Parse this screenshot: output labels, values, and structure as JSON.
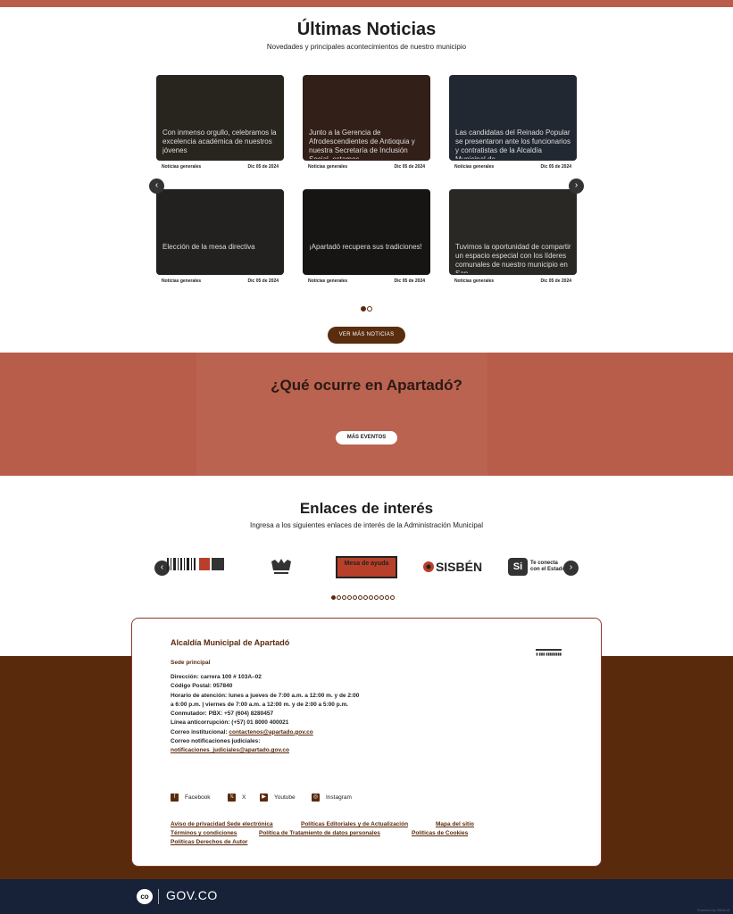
{
  "news": {
    "title": "Últimas Noticias",
    "subtitle": "Novedades y principales acontecimientos de nuestro municipio",
    "prev_arrow": "‹",
    "next_arrow": "›",
    "cards": [
      {
        "title": "Con inmenso orgullo, celebramos la excelencia académica de nuestros jóvenes",
        "category": "Noticias generales",
        "date": "Dic 05 de 2024",
        "color": "#4a4238"
      },
      {
        "title": "Junto a la Gerencia de Afrodescendientes de Antioquia y nuestra Secretaría de Inclusión Social, estamos",
        "category": "Noticias generales",
        "date": "Dic 05 de 2024",
        "color": "#5b3a2c"
      },
      {
        "title": "Las candidatas del Reinado Popular se presentaron ante los funcionarios y contratistas de la Alcaldía Municipal de",
        "category": "Noticias generales",
        "date": "Dic 05 de 2024",
        "color": "#3f4a5a"
      },
      {
        "title": "Elección de la mesa directiva",
        "category": "Noticias generales",
        "date": "Dic 05 de 2024",
        "color": "#3e3d3a"
      },
      {
        "title": "¡Apartadó recupera sus tradiciones!",
        "category": "Noticias generales",
        "date": "Dic 05 de 2024",
        "color": "#2b2626"
      },
      {
        "title": "Tuvimos la oportunidad de compartir un espacio especial con los líderes comunales de nuestro municipio en San",
        "category": "Noticias generales",
        "date": "Dic 05 de 2024",
        "color": "#4d4a44"
      }
    ],
    "button": "VER MÁS NOTICIAS"
  },
  "events": {
    "title": "¿Qué ocurre en Apartadó?",
    "button": "MÁS EVENTOS"
  },
  "links": {
    "title": "Enlaces de interés",
    "subtitle": "Ingresa a los siguientes enlaces de interés de la Administración Municipal",
    "logos": [
      {
        "label": "Colombia Compra Eficiente",
        "icon": "barcode-logo"
      },
      {
        "label": "Urna de Cristal",
        "icon": "urna-logo"
      },
      {
        "label": "Mesa de ayuda",
        "icon": "mesa-de-ayuda-logo"
      },
      {
        "label": "SISBÉN",
        "icon": "sisben-logo"
      },
      {
        "label": "Si Te conecta con el Estado",
        "icon": "si-logo"
      }
    ],
    "prev_arrow": "‹",
    "next_arrow": "›"
  },
  "footer": {
    "org": "Alcaldía Municipal de Apartadó",
    "sede": "Sede principal",
    "address": "Dirección: carrera 100 # 103A–02",
    "postal": "Código Postal: 057840",
    "hours": "Horario de atención: lunes a jueves de 7:00 a.m. a 12:00 m. y de 2:00 a 6:00 p.m. | viernes de 7:00 a.m. a 12:00 m. y de 2:00 a 5:00 p.m.",
    "pbx": "Conmutador: PBX: +57 (604) 8280457",
    "anticorruption": "Línea anticorrupción: (+57) 01 8000 400021",
    "email_label": "Correo institucional:",
    "email": "contactenos@apartado.gov.co",
    "notif_label": "Correo notificaciones judiciales:",
    "notif_email": "notificaciones_judiciales@apartado.gov.co",
    "social": [
      {
        "label": "Facebook",
        "icon": "f"
      },
      {
        "label": "X",
        "icon": "𝕏"
      },
      {
        "label": "Youtube",
        "icon": "▶"
      },
      {
        "label": "Instagram",
        "icon": "◎"
      }
    ],
    "policies": [
      "Aviso de privacidad Sede electrónica",
      "Políticas Editoriales y de Actualización",
      "Mapa del sitio",
      "Términos y condiciones",
      "Política de Tratamiento de datos personales",
      "Políticas de Cookies",
      "Políticas Derechos de Autor"
    ]
  },
  "gov": {
    "co": "co",
    "label": "GOV.CO",
    "powered": "Powered by SEALIA"
  }
}
